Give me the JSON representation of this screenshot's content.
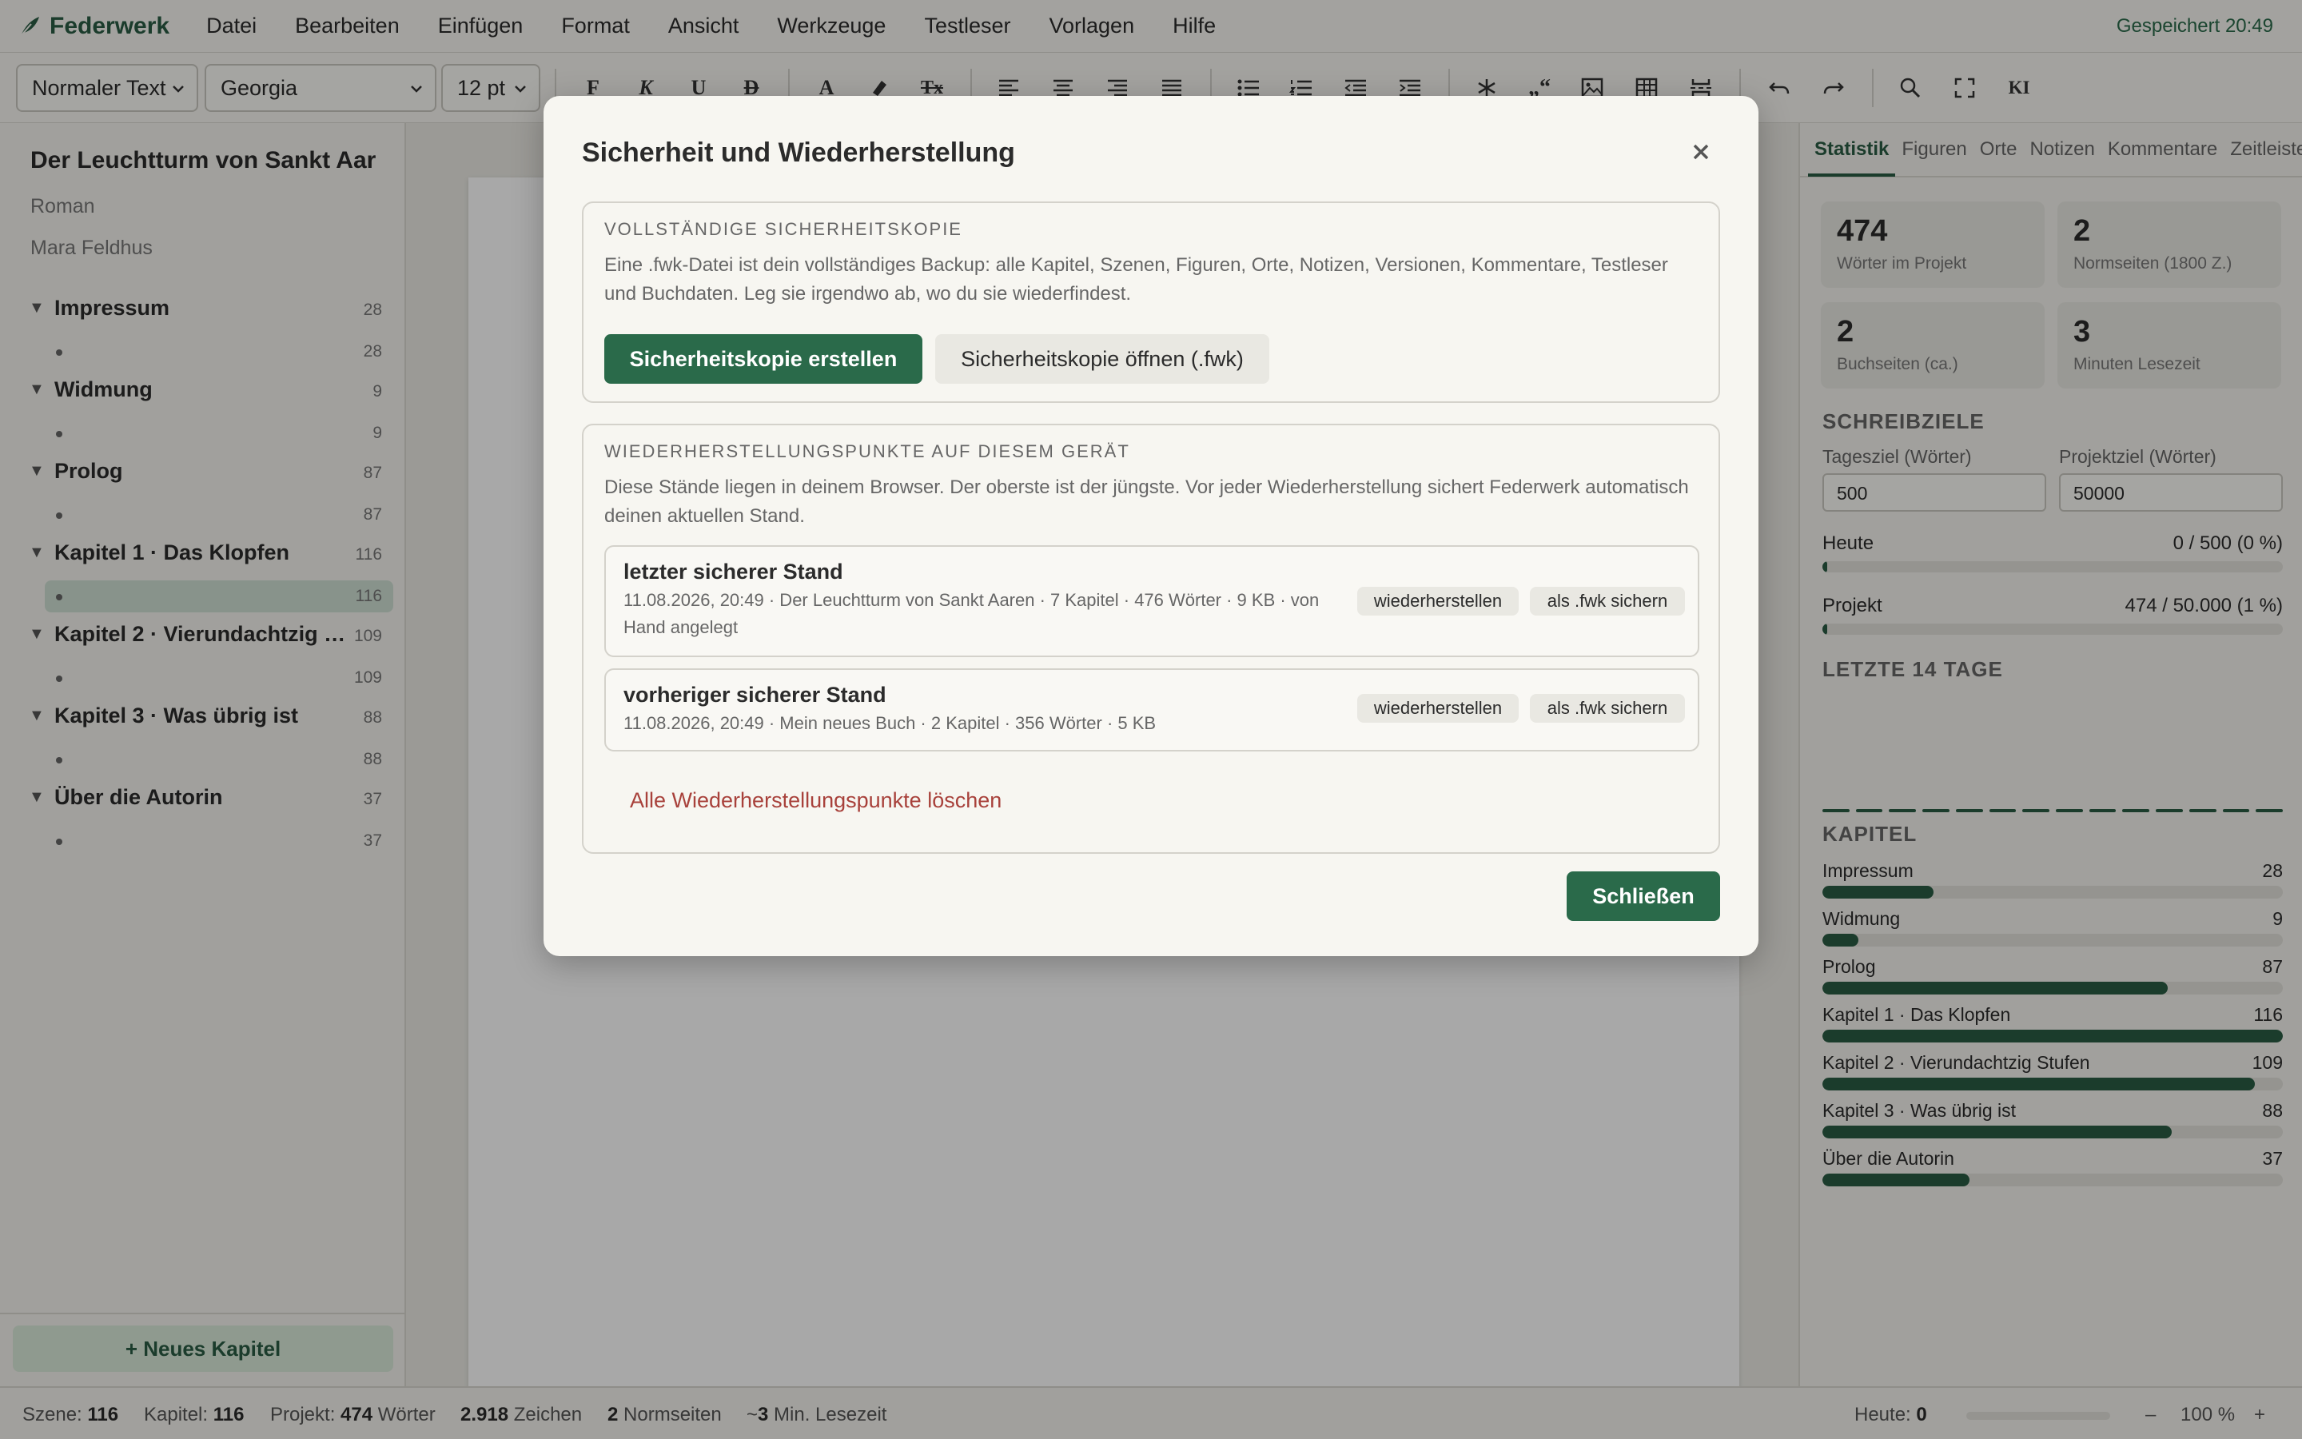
{
  "app": {
    "name": "Federwerk",
    "saved_status": "Gespeichert 20:49"
  },
  "menu": [
    "Datei",
    "Bearbeiten",
    "Einfügen",
    "Format",
    "Ansicht",
    "Werkzeuge",
    "Testleser",
    "Vorlagen",
    "Hilfe"
  ],
  "toolbar": {
    "style": "Normaler Text",
    "font": "Georgia",
    "size": "12 pt",
    "bold": "F",
    "italic": "K",
    "underline": "U",
    "strike": "D",
    "textcolor": "A",
    "clear": "Tx",
    "ai": "KI"
  },
  "book": {
    "title": "Der Leuchtturm von Sankt Aar",
    "genre": "Roman",
    "author": "Mara Feldhus"
  },
  "chapters": [
    {
      "title": "Impressum",
      "count": "28",
      "scene_count": "28"
    },
    {
      "title": "Widmung",
      "count": "9",
      "scene_count": "9"
    },
    {
      "title": "Prolog",
      "count": "87",
      "scene_count": "87"
    },
    {
      "title": "Kapitel 1 · Das Klopfen",
      "count": "116",
      "scene_count": "116"
    },
    {
      "title": "Kapitel 2 · Vierundachtzig Stufen",
      "count": "109",
      "scene_count": "109"
    },
    {
      "title": "Kapitel 3 · Was übrig ist",
      "count": "88",
      "scene_count": "88"
    },
    {
      "title": "Über die Autorin",
      "count": "37",
      "scene_count": "37"
    }
  ],
  "sidebar": {
    "new_chapter": "+ Neues Kapitel"
  },
  "right_panel": {
    "tabs": [
      "Statistik",
      "Figuren",
      "Orte",
      "Notizen",
      "Kommentare",
      "Zeitleiste"
    ],
    "stats": [
      {
        "num": "474",
        "label": "Wörter im Projekt"
      },
      {
        "num": "2",
        "label": "Normseiten (1800 Z.)"
      },
      {
        "num": "2",
        "label": "Buchseiten (ca.)"
      },
      {
        "num": "3",
        "label": "Minuten Lesezeit"
      }
    ],
    "goals_head": "SCHREIBZIELE",
    "day_goal_label": "Tagesziel (Wörter)",
    "day_goal_value": "500",
    "project_goal_label": "Projektziel (Wörter)",
    "project_goal_value": "50000",
    "today_label": "Heute",
    "today_value": "0 / 500 (0 %)",
    "today_fraction": 0.0,
    "project_label": "Projekt",
    "project_value": "474 / 50.000 (1 %)",
    "project_fraction": 0.01,
    "days_head": "LETZTE 14 TAGE",
    "chapters_head": "KAPITEL",
    "chapter_stats": [
      {
        "name": "Impressum",
        "value": 28
      },
      {
        "name": "Widmung",
        "value": 9
      },
      {
        "name": "Prolog",
        "value": 87
      },
      {
        "name": "Kapitel 1 · Das Klopfen",
        "value": 116
      },
      {
        "name": "Kapitel 2 · Vierundachtzig Stufen",
        "value": 109
      },
      {
        "name": "Kapitel 3 · Was übrig ist",
        "value": 88
      },
      {
        "name": "Über die Autorin",
        "value": 37
      }
    ]
  },
  "statusbar": {
    "scene_label": "Szene:",
    "scene_value": "116",
    "chapter_label": "Kapitel:",
    "chapter_value": "116",
    "project_label": "Projekt:",
    "project_value": "474",
    "project_unit": "Wörter",
    "chars_value": "2.918",
    "chars_unit": "Zeichen",
    "pages_value": "2",
    "pages_unit": "Normseiten",
    "read_prefix": "~",
    "read_value": "3",
    "read_unit": "Min. Lesezeit",
    "today_label": "Heute:",
    "today_value": "0",
    "zoom_minus": "–",
    "zoom": "100 %",
    "zoom_plus": "+"
  },
  "modal": {
    "title": "Sicherheit und Wiederherstellung",
    "backup_head": "VOLLSTÄNDIGE SICHERHEITSKOPIE",
    "backup_text": "Eine .fwk-Datei ist dein vollständiges Backup: alle Kapitel, Szenen, Figuren, Orte, Notizen, Versionen, Kommentare, Testleser und Buchdaten. Leg sie irgendwo ab, wo du sie wiederfindest.",
    "create_backup": "Sicherheitskopie erstellen",
    "open_backup": "Sicherheitskopie öffnen (.fwk)",
    "restore_head": "WIEDERHERSTELLUNGSPUNKTE AUF DIESEM GERÄT",
    "restore_text": "Diese Stände liegen in deinem Browser. Der oberste ist der jüngste. Vor jeder Wiederherstellung sichert Federwerk automatisch deinen aktuellen Stand.",
    "points": [
      {
        "name": "letzter sicherer Stand",
        "meta": "11.08.2026, 20:49 · Der Leuchtturm von Sankt Aaren · 7 Kapitel · 476 Wörter · 9 KB · von Hand angelegt"
      },
      {
        "name": "vorheriger sicherer Stand",
        "meta": "11.08.2026, 20:49 · Mein neues Buch · 2 Kapitel · 356 Wörter · 5 KB"
      }
    ],
    "restore_btn": "wiederherstellen",
    "save_fwk_btn": "als .fwk sichern",
    "delete_all": "Alle Wiederherstellungspunkte löschen",
    "close": "Schließen"
  }
}
